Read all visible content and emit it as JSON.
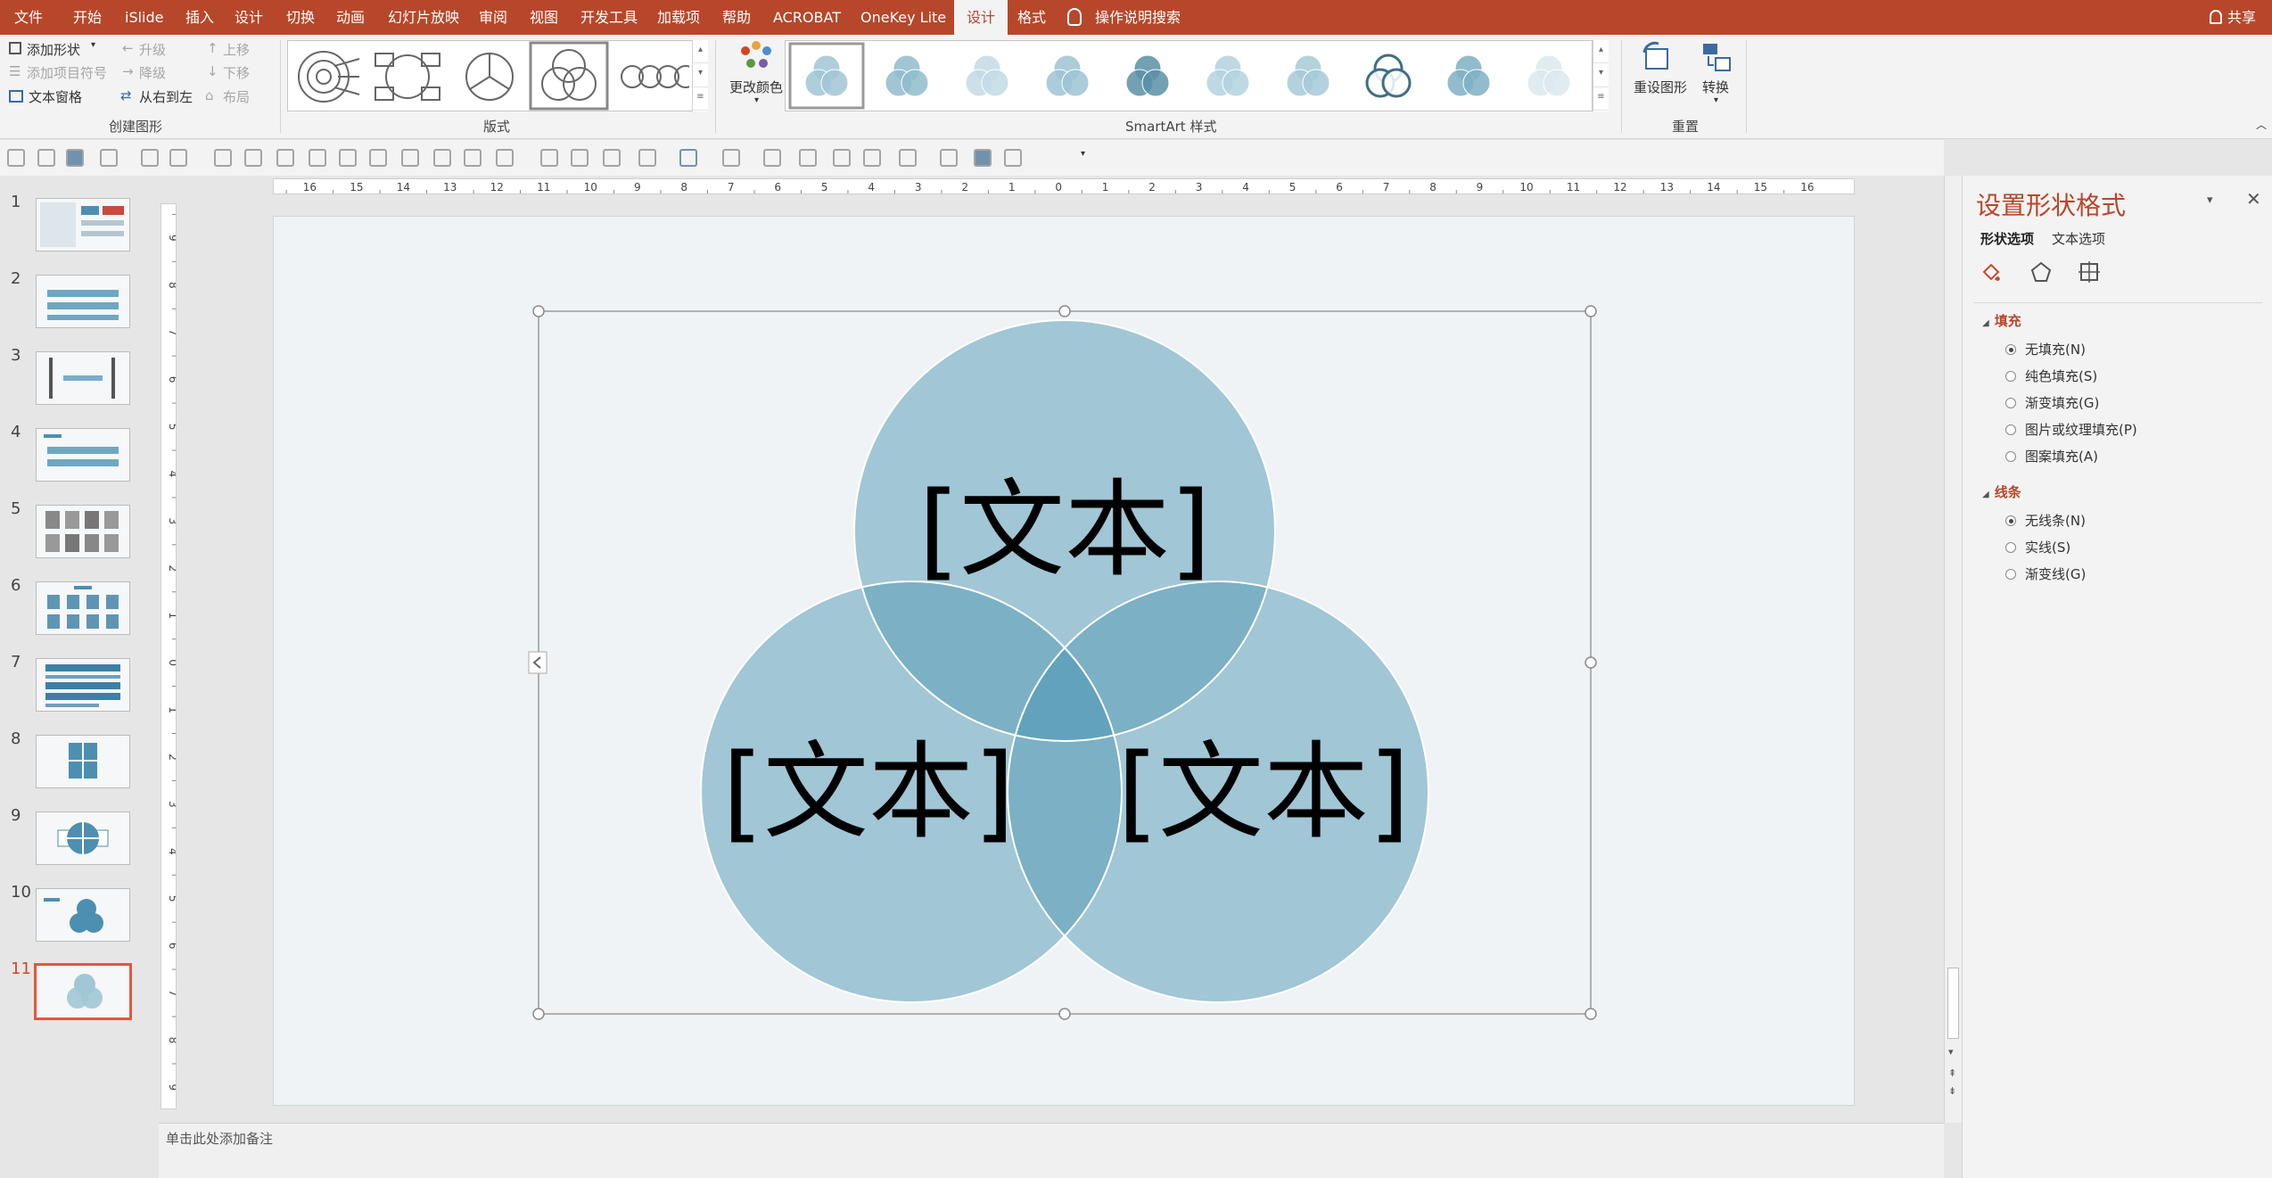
{
  "menu": {
    "items": [
      "文件",
      "开始",
      "iSlide",
      "插入",
      "设计",
      "切换",
      "动画",
      "幻灯片放映",
      "审阅",
      "视图",
      "开发工具",
      "加载项",
      "帮助",
      "ACROBAT",
      "OneKey Lite",
      "设计",
      "格式"
    ],
    "active_index": 15,
    "search": "操作说明搜索",
    "share": "共享"
  },
  "ribbon": {
    "create_graphic": {
      "add_shape": "添加形状",
      "add_bullet": "添加项目符号",
      "text_pane": "文本窗格",
      "promote": "升级",
      "demote": "降级",
      "right_to_left": "从右到左",
      "move_up": "上移",
      "move_down": "下移",
      "layout_btn": "布局",
      "label": "创建图形"
    },
    "layouts_label": "版式",
    "change_colors": "更改颜色",
    "smartart_styles_label": "SmartArt 样式",
    "reset_graphic": "重设图形",
    "convert": "转换",
    "reset_label": "重置"
  },
  "ruler": {
    "h_labels": [
      "16",
      "15",
      "14",
      "13",
      "12",
      "11",
      "10",
      "9",
      "8",
      "7",
      "6",
      "5",
      "4",
      "3",
      "2",
      "1",
      "0",
      "1",
      "2",
      "3",
      "4",
      "5",
      "6",
      "7",
      "8",
      "9",
      "10",
      "11",
      "12",
      "13",
      "14",
      "15",
      "16"
    ],
    "v_labels": [
      "9",
      "8",
      "7",
      "6",
      "5",
      "4",
      "3",
      "2",
      "1",
      "0",
      "1",
      "2",
      "3",
      "4",
      "5",
      "6",
      "7",
      "8",
      "9"
    ]
  },
  "slides": {
    "numbers": [
      "1",
      "2",
      "3",
      "4",
      "5",
      "6",
      "7",
      "8",
      "9",
      "10",
      "11"
    ],
    "active_index": 10
  },
  "venn": {
    "labels": [
      "[文本]",
      "[文本]",
      "[文本]"
    ],
    "colors": {
      "circle": "#a1c6d5",
      "overlap2": "#7bb0c5",
      "overlap3": "#62a2bd"
    }
  },
  "notes": {
    "placeholder": "单击此处添加备注"
  },
  "format_pane": {
    "title": "设置形状格式",
    "tabs": [
      "形状选项",
      "文本选项"
    ],
    "fill": {
      "label": "填充",
      "options": [
        "无填充(N)",
        "纯色填充(S)",
        "渐变填充(G)",
        "图片或纹理填充(P)",
        "图案填充(A)"
      ],
      "selected": 0
    },
    "line": {
      "label": "线条",
      "options": [
        "无线条(N)",
        "实线(S)",
        "渐变线(G)"
      ],
      "selected": 0
    }
  },
  "colors": {
    "accent": "#b7472a"
  }
}
